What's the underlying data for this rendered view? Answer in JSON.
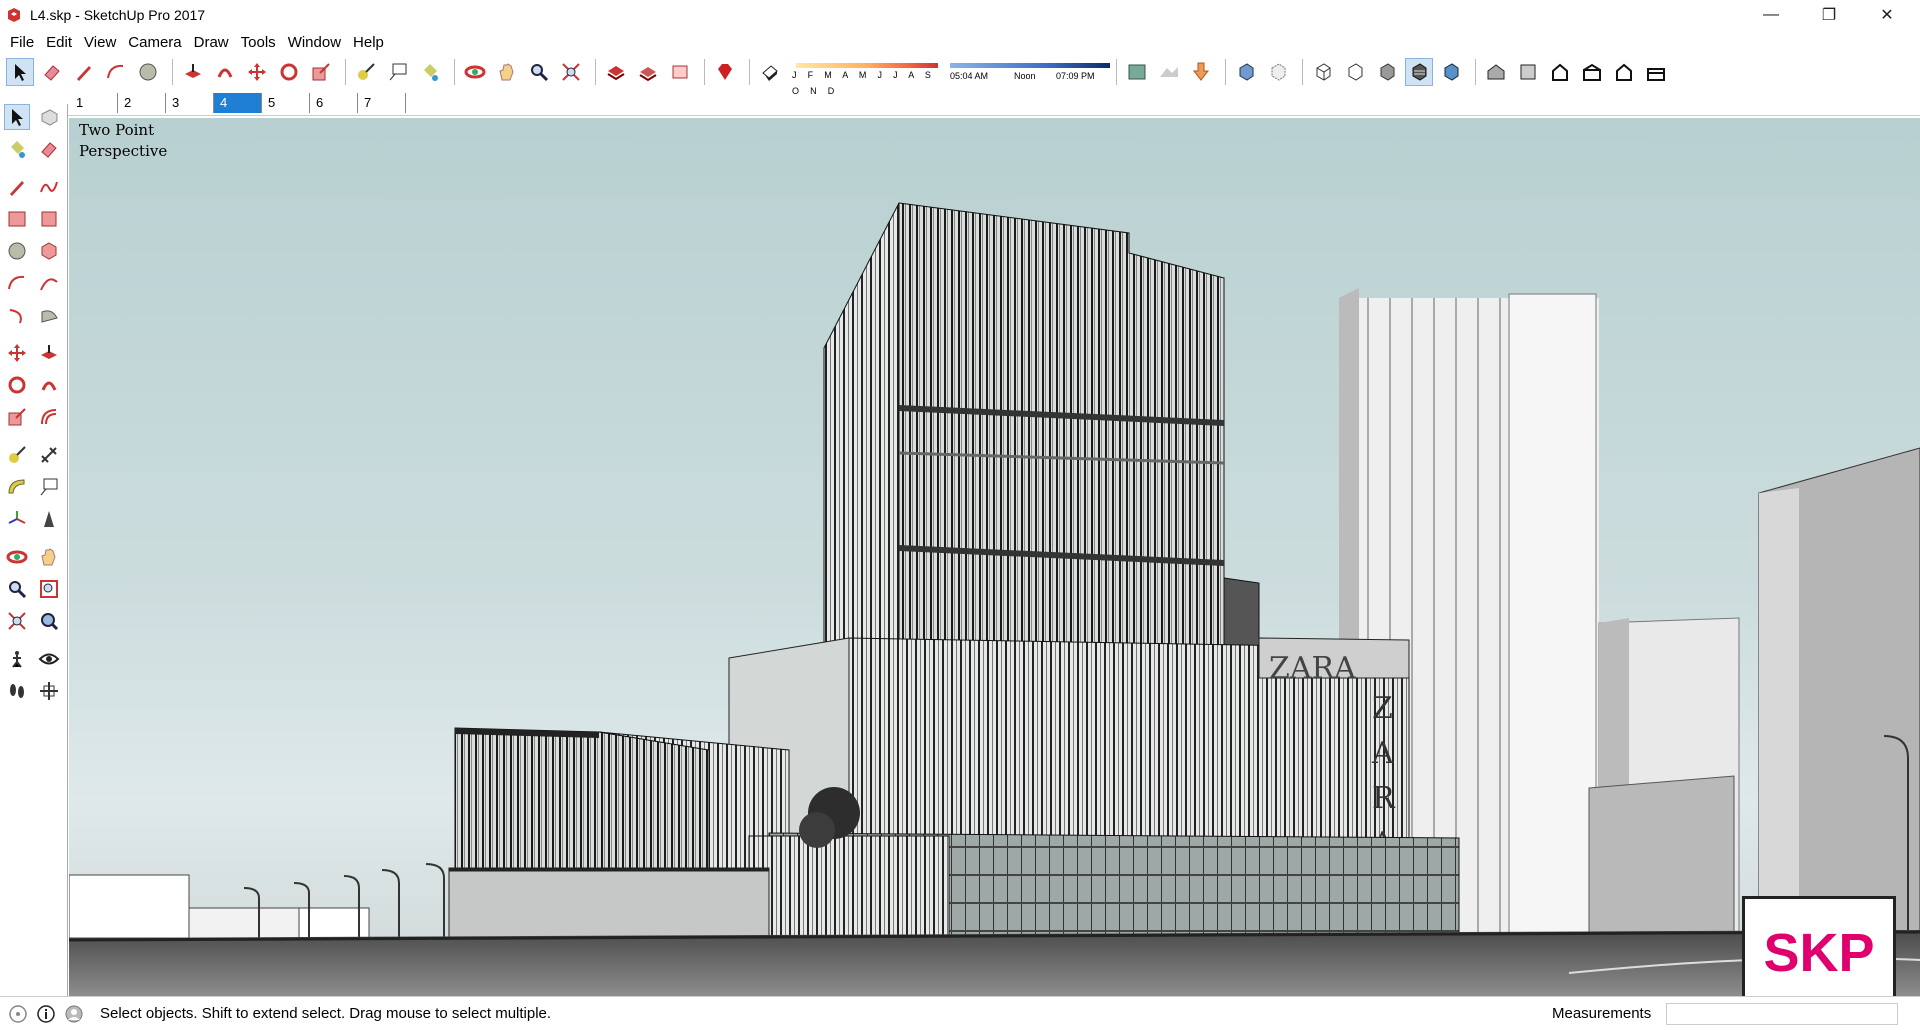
{
  "window": {
    "title": "L4.skp - SketchUp Pro 2017"
  },
  "menu": [
    "File",
    "Edit",
    "View",
    "Camera",
    "Draw",
    "Tools",
    "Window",
    "Help"
  ],
  "shadow": {
    "months": "J F M A M J J A S O N D",
    "time_start": "05:04 AM",
    "time_mid": "Noon",
    "time_end": "07:09 PM"
  },
  "scenes": {
    "tabs": [
      "1",
      "2",
      "3",
      "4",
      "5",
      "6",
      "7"
    ],
    "active": "4"
  },
  "viewport": {
    "label": "Two Point\nPerspective",
    "badge": "SKP",
    "badge_color": "#e0006d",
    "sign_text": "ZARA"
  },
  "status": {
    "hint": "Select objects. Shift to extend select. Drag mouse to select multiple.",
    "measurements_label": "Measurements",
    "measurements_value": ""
  },
  "colors": {
    "accent": "#1e7fd4"
  }
}
